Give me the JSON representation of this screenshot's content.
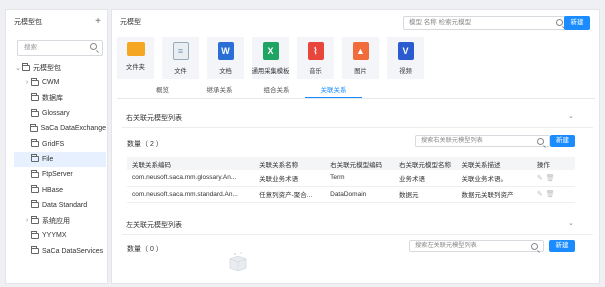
{
  "left": {
    "title": "元模型包",
    "add": "+",
    "search_placeholder": "搜索",
    "tree": [
      {
        "label": "元模型包",
        "expanded": true,
        "level": 0
      },
      {
        "label": "CWM",
        "expanded": false,
        "level": 1
      },
      {
        "label": "数据库",
        "level": 1
      },
      {
        "label": "Glossary",
        "level": 1
      },
      {
        "label": "SaCa DataExchange",
        "level": 1
      },
      {
        "label": "GridFS",
        "level": 1
      },
      {
        "label": "File",
        "level": 1,
        "selected": true
      },
      {
        "label": "FtpServer",
        "level": 1
      },
      {
        "label": "HBase",
        "level": 1
      },
      {
        "label": "Data Standard",
        "level": 1
      },
      {
        "label": "系统应用",
        "expanded": false,
        "level": 1
      },
      {
        "label": "YYYMX",
        "level": 1
      },
      {
        "label": "SaCa DataServices",
        "level": 1
      }
    ]
  },
  "right": {
    "title": "元模型",
    "search_placeholder": "模型 名称 检索元模型",
    "new_label": "新建",
    "tiles": [
      {
        "label": "文件夹",
        "icon": "folder-icon",
        "color": "#f5a623"
      },
      {
        "label": "文件",
        "icon": "file-icon",
        "color": "#e9eef3"
      },
      {
        "label": "文档",
        "icon": "word-icon",
        "color": "#2b6fd6"
      },
      {
        "label": "通用采集模板",
        "icon": "excel-icon",
        "color": "#1fa463"
      },
      {
        "label": "音乐",
        "icon": "pdf-icon",
        "color": "#e8453c"
      },
      {
        "label": "图片",
        "icon": "image-icon",
        "color": "#f26b3a"
      },
      {
        "label": "视频",
        "icon": "video-icon",
        "color": "#2b5ccf"
      }
    ],
    "tabs": [
      "概览",
      "继承关系",
      "组合关系",
      "关联关系"
    ],
    "active_tab": 3,
    "assoc": {
      "title": "右关联元模型列表",
      "count": "数量（ 2 ）",
      "search_placeholder": "搜索右关联元模型列表",
      "new_label": "新建",
      "columns": [
        "关联关系编码",
        "关联关系名称",
        "右关联元模型编码",
        "右关联元模型名称",
        "关联关系描述",
        "操作"
      ],
      "rows": [
        [
          "com.neusoft.saca.mm.glossary.An...",
          "关联业务术语",
          "Term",
          "业务术语",
          "关联业务术语。"
        ],
        [
          "com.neusoft.saca.mm.standard.An...",
          "任意列资产-聚合...",
          "DataDomain",
          "数据元",
          "数据元关联列资产"
        ]
      ]
    },
    "left_assoc": {
      "title": "左关联元模型列表",
      "count": "数量（ 0 ）",
      "search_placeholder": "搜索左关联元模型列表",
      "new_label": "新建"
    }
  }
}
